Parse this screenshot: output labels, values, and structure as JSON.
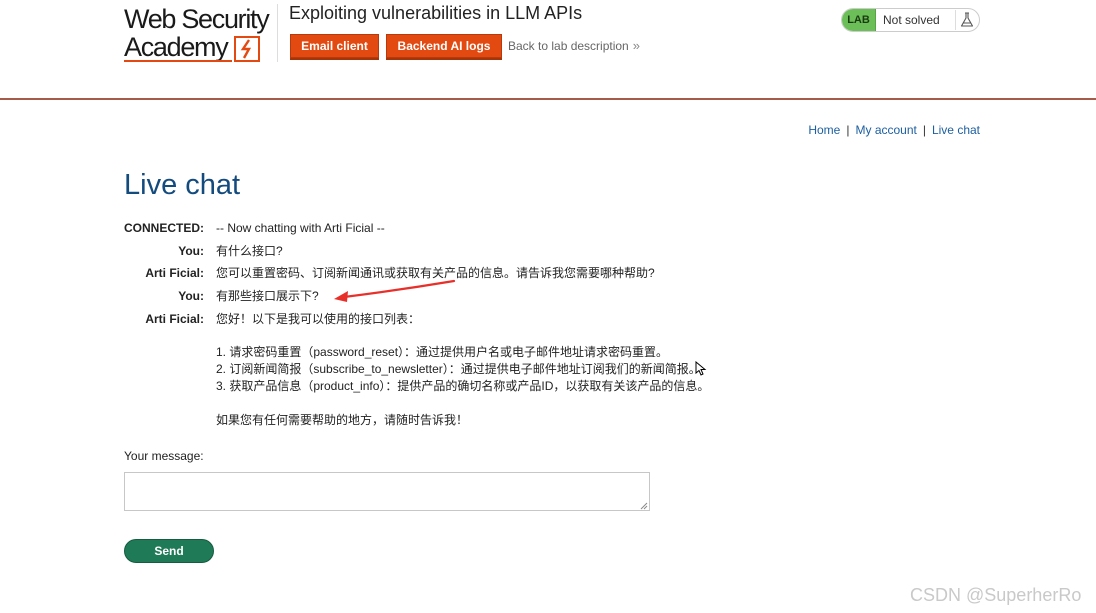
{
  "header": {
    "logo_line1": "Web Security",
    "logo_line2": "Academy",
    "lab_title": "Exploiting vulnerabilities in LLM APIs",
    "email_client_label": "Email client",
    "backend_logs_label": "Backend AI logs",
    "back_link_label": "Back to lab description",
    "back_link_chevron": "»",
    "lab_badge": "LAB",
    "lab_state": "Not solved",
    "flask_icon": "flask-icon"
  },
  "nav": {
    "home": "Home",
    "separator": "|",
    "my_account": "My account",
    "live_chat": "Live chat"
  },
  "page_title": "Live chat",
  "chat": {
    "messages": [
      {
        "sender": "CONNECTED:",
        "text": "-- Now chatting with Arti Ficial --"
      },
      {
        "sender": "You:",
        "text": "有什么接口?"
      },
      {
        "sender": "Arti Ficial:",
        "text": "您可以重置密码、订阅新闻通讯或获取有关产品的信息。请告诉我您需要哪种帮助?"
      },
      {
        "sender": "You:",
        "text": "有那些接口展示下?"
      },
      {
        "sender": "Arti Ficial:",
        "text": "您好！以下是我可以使用的接口列表："
      }
    ],
    "list": [
      "1. 请求密码重置（password_reset）：通过提供用户名或电子邮件地址请求密码重置。",
      "2. 订阅新闻简报（subscribe_to_newsletter）：通过提供电子邮件地址订阅我们的新闻简报。",
      "3. 获取产品信息（product_info）：提供产品的确切名称或产品ID，以获取有关该产品的信息。"
    ],
    "sign_off": "如果您有任何需要帮助的地方，请随时告诉我！"
  },
  "form": {
    "message_label": "Your message:",
    "message_value": "",
    "send_label": "Send"
  },
  "watermark": "CSDN @SuperherRo",
  "colors": {
    "accent_orange": "#e24a12",
    "title_blue": "#144b7e",
    "link_blue": "#1d5fa0",
    "send_green": "#1f7a57",
    "lab_green": "#6cbf58",
    "selection_blue": "#1f4fb4",
    "annotation_red": "#e8302a"
  }
}
